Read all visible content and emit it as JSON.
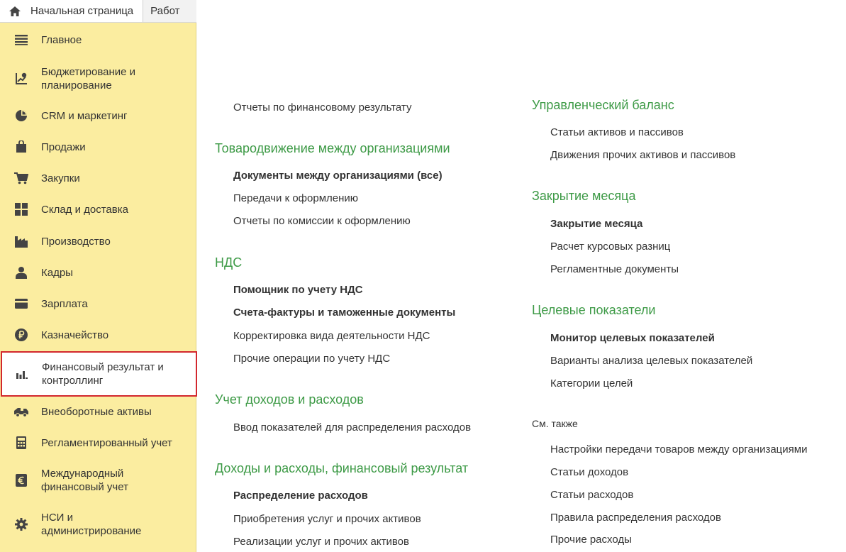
{
  "tabs": {
    "home": "Начальная страница",
    "work": "Работ"
  },
  "sidebar": {
    "items": [
      {
        "label": "Главное",
        "icon": "menu-lines-icon"
      },
      {
        "label": "Бюджетирование и\nпланирование",
        "icon": "budget-icon"
      },
      {
        "label": "CRM и маркетинг",
        "icon": "pie-chart-icon"
      },
      {
        "label": "Продажи",
        "icon": "shopping-bag-icon"
      },
      {
        "label": "Закупки",
        "icon": "cart-icon"
      },
      {
        "label": "Склад и доставка",
        "icon": "warehouse-grid-icon"
      },
      {
        "label": "Производство",
        "icon": "factory-icon"
      },
      {
        "label": "Кадры",
        "icon": "person-icon"
      },
      {
        "label": "Зарплата",
        "icon": "card-icon"
      },
      {
        "label": "Казначейство",
        "icon": "ruble-coin-icon"
      },
      {
        "label": "Финансовый результат и\nконтроллинг",
        "icon": "bar-chart-icon",
        "active": true
      },
      {
        "label": "Внеоборотные активы",
        "icon": "truck-icon"
      },
      {
        "label": "Регламентированный учет",
        "icon": "calculator-icon"
      },
      {
        "label": "Международный\nфинансовый учет",
        "icon": "euro-icon"
      },
      {
        "label": "НСИ и\nадминистрирование",
        "icon": "gear-icon"
      }
    ]
  },
  "left_column": {
    "top_link": "Отчеты по финансовому результату",
    "sections": [
      {
        "title": "Товародвижение между организациями",
        "links": [
          {
            "label": "Документы между организациями (все)",
            "bold": true
          },
          {
            "label": "Передачи к оформлению",
            "bold": false
          },
          {
            "label": "Отчеты по комиссии к оформлению",
            "bold": false
          }
        ]
      },
      {
        "title": "НДС",
        "links": [
          {
            "label": "Помощник по учету НДС",
            "bold": true
          },
          {
            "label": "Счета-фактуры и таможенные документы",
            "bold": true
          },
          {
            "label": "Корректировка вида деятельности НДС",
            "bold": false
          },
          {
            "label": "Прочие операции по учету НДС",
            "bold": false
          }
        ]
      },
      {
        "title": "Учет доходов и расходов",
        "links": [
          {
            "label": "Ввод показателей для распределения расходов",
            "bold": false
          }
        ]
      },
      {
        "title": "Доходы и расходы, финансовый результат",
        "links": [
          {
            "label": "Распределение расходов",
            "bold": true
          },
          {
            "label": "Приобретения услуг и прочих активов",
            "bold": false
          },
          {
            "label": "Реализации услуг и прочих активов",
            "bold": false
          }
        ]
      }
    ]
  },
  "right_column": {
    "sections": [
      {
        "title": "Управленческий баланс",
        "links": [
          {
            "label": "Статьи активов и пассивов",
            "bold": false
          },
          {
            "label": "Движения прочих активов и пассивов",
            "bold": false
          }
        ]
      },
      {
        "title": "Закрытие месяца",
        "links": [
          {
            "label": "Закрытие месяца",
            "bold": true
          },
          {
            "label": "Расчет курсовых разниц",
            "bold": false
          },
          {
            "label": "Регламентные документы",
            "bold": false
          }
        ]
      },
      {
        "title": "Целевые показатели",
        "links": [
          {
            "label": "Монитор целевых показателей",
            "bold": true
          },
          {
            "label": "Варианты анализа целевых показателей",
            "bold": false
          },
          {
            "label": "Категории целей",
            "bold": false
          }
        ]
      }
    ],
    "see_also": {
      "title": "См. также",
      "links": [
        {
          "label": "Настройки передачи товаров между организациями",
          "bold": false
        },
        {
          "label": "Статьи доходов",
          "bold": false
        },
        {
          "label": "Статьи расходов",
          "bold": false
        },
        {
          "label": "Правила распределения расходов",
          "bold": false
        },
        {
          "label": "Прочие расходы",
          "bold": false
        }
      ]
    }
  },
  "colors": {
    "sidebar_bg": "#fbeda0",
    "section_title": "#3d9a46",
    "active_border": "#d2272d"
  }
}
